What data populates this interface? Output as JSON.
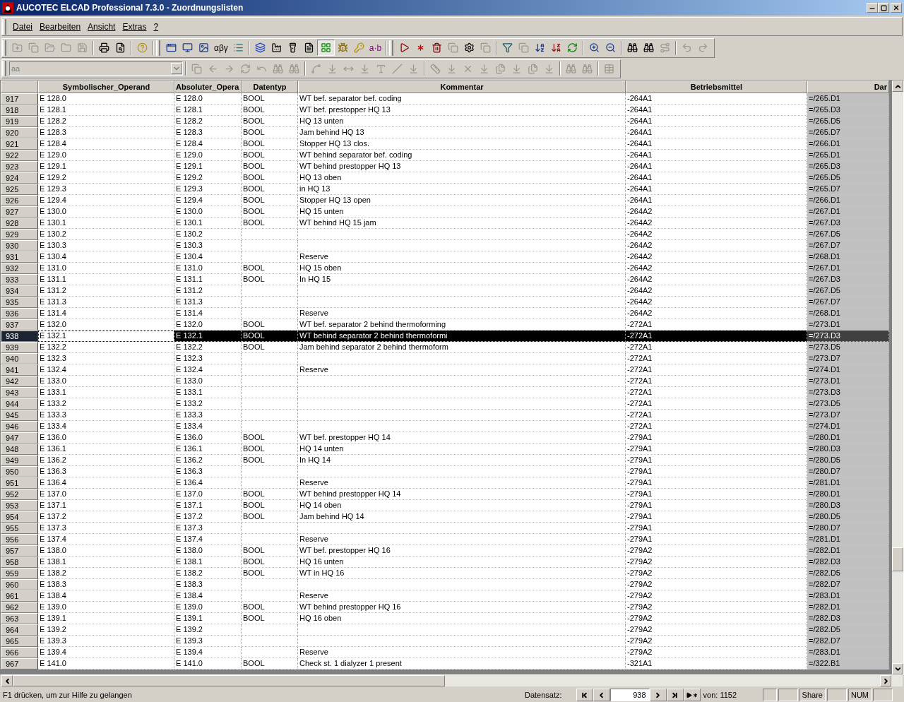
{
  "window": {
    "title": "AUCOTEC ELCAD Professional 7.3.0 - Zuordnungslisten"
  },
  "menu": [
    {
      "label": "Datei"
    },
    {
      "label": "Bearbeiten"
    },
    {
      "label": "Ansicht"
    },
    {
      "label": "Extras"
    },
    {
      "label": "?"
    }
  ],
  "toolbar": {
    "greek_label": "αβγ",
    "ab_label": "a·b",
    "style_dropdown": {
      "value": "aa",
      "disabled": true
    }
  },
  "table": {
    "columns": [
      "Symbolischer_Operand",
      "Absoluter_Opera",
      "Datentyp",
      "Kommentar",
      "Betriebsmittel",
      "Dar"
    ],
    "rows": [
      {
        "n": "917",
        "sym": "E 128.0",
        "abs": "E 128.0",
        "typ": "BOOL",
        "komm": "WT bef. separator bef. coding",
        "bm": "-264A1",
        "dar": "=/265.D1",
        "selected": false
      },
      {
        "n": "918",
        "sym": "E 128.1",
        "abs": "E 128.1",
        "typ": "BOOL",
        "komm": "WT bef. prestopper HQ 13",
        "bm": "-264A1",
        "dar": "=/265.D3",
        "selected": false
      },
      {
        "n": "919",
        "sym": "E 128.2",
        "abs": "E 128.2",
        "typ": "BOOL",
        "komm": "HQ 13 unten",
        "bm": "-264A1",
        "dar": "=/265.D5",
        "selected": false
      },
      {
        "n": "920",
        "sym": "E 128.3",
        "abs": "E 128.3",
        "typ": "BOOL",
        "komm": "Jam behind HQ 13",
        "bm": "-264A1",
        "dar": "=/265.D7",
        "selected": false
      },
      {
        "n": "921",
        "sym": "E 128.4",
        "abs": "E 128.4",
        "typ": "BOOL",
        "komm": "Stopper HQ 13 clos.",
        "bm": "-264A1",
        "dar": "=/266.D1",
        "selected": false
      },
      {
        "n": "922",
        "sym": "E 129.0",
        "abs": "E 129.0",
        "typ": "BOOL",
        "komm": "WT behind separator bef. coding",
        "bm": "-264A1",
        "dar": "=/265.D1",
        "selected": false
      },
      {
        "n": "923",
        "sym": "E 129.1",
        "abs": "E 129.1",
        "typ": "BOOL",
        "komm": "WT behind prestopper HQ 13",
        "bm": "-264A1",
        "dar": "=/265.D3",
        "selected": false
      },
      {
        "n": "924",
        "sym": "E 129.2",
        "abs": "E 129.2",
        "typ": "BOOL",
        "komm": "HQ 13 oben",
        "bm": "-264A1",
        "dar": "=/265.D5",
        "selected": false
      },
      {
        "n": "925",
        "sym": "E 129.3",
        "abs": "E 129.3",
        "typ": "BOOL",
        "komm": "in HQ 13",
        "bm": "-264A1",
        "dar": "=/265.D7",
        "selected": false
      },
      {
        "n": "926",
        "sym": "E 129.4",
        "abs": "E 129.4",
        "typ": "BOOL",
        "komm": "Stopper HQ 13 open",
        "bm": "-264A1",
        "dar": "=/266.D1",
        "selected": false
      },
      {
        "n": "927",
        "sym": "E 130.0",
        "abs": "E 130.0",
        "typ": "BOOL",
        "komm": "HQ 15 unten",
        "bm": "-264A2",
        "dar": "=/267.D1",
        "selected": false
      },
      {
        "n": "928",
        "sym": "E 130.1",
        "abs": "E 130.1",
        "typ": "BOOL",
        "komm": "WT behind HQ 15 jam",
        "bm": "-264A2",
        "dar": "=/267.D3",
        "selected": false
      },
      {
        "n": "929",
        "sym": "E 130.2",
        "abs": "E 130.2",
        "bm": "-264A2",
        "dar": "=/267.D5",
        "selected": false
      },
      {
        "n": "930",
        "sym": "E 130.3",
        "abs": "E 130.3",
        "bm": "-264A2",
        "dar": "=/267.D7",
        "selected": false
      },
      {
        "n": "931",
        "sym": "E 130.4",
        "abs": "E 130.4",
        "komm": "Reserve",
        "bm": "-264A2",
        "dar": "=/268.D1",
        "selected": false
      },
      {
        "n": "932",
        "sym": "E 131.0",
        "abs": "E 131.0",
        "typ": "BOOL",
        "komm": "HQ 15 oben",
        "bm": "-264A2",
        "dar": "=/267.D1",
        "selected": false
      },
      {
        "n": "933",
        "sym": "E 131.1",
        "abs": "E 131.1",
        "typ": "BOOL",
        "komm": "In HQ 15",
        "bm": "-264A2",
        "dar": "=/267.D3",
        "selected": false
      },
      {
        "n": "934",
        "sym": "E 131.2",
        "abs": "E 131.2",
        "bm": "-264A2",
        "dar": "=/267.D5",
        "selected": false
      },
      {
        "n": "935",
        "sym": "E 131.3",
        "abs": "E 131.3",
        "bm": "-264A2",
        "dar": "=/267.D7",
        "selected": false
      },
      {
        "n": "936",
        "sym": "E 131.4",
        "abs": "E 131.4",
        "komm": "Reserve",
        "bm": "-264A2",
        "dar": "=/268.D1",
        "selected": false
      },
      {
        "n": "937",
        "sym": "E 132.0",
        "abs": "E 132.0",
        "typ": "BOOL",
        "komm": "WT bef. separator 2 behind thermoforming",
        "bm": "-272A1",
        "dar": "=/273.D1",
        "selected": false
      },
      {
        "n": "938",
        "sym": "E 132.1",
        "abs": "E 132.1",
        "typ": "BOOL",
        "komm": "WT behind separator 2 behind thermoformi",
        "bm": "-272A1",
        "dar": "=/273.D3",
        "selected": true
      },
      {
        "n": "939",
        "sym": "E 132.2",
        "abs": "E 132.2",
        "typ": "BOOL",
        "komm": "Jam behind separator 2 behind thermoform",
        "bm": "-272A1",
        "dar": "=/273.D5",
        "selected": false
      },
      {
        "n": "940",
        "sym": "E 132.3",
        "abs": "E 132.3",
        "bm": "-272A1",
        "dar": "=/273.D7",
        "selected": false
      },
      {
        "n": "941",
        "sym": "E 132.4",
        "abs": "E 132.4",
        "komm": "Reserve",
        "bm": "-272A1",
        "dar": "=/274.D1",
        "selected": false
      },
      {
        "n": "942",
        "sym": "E 133.0",
        "abs": "E 133.0",
        "bm": "-272A1",
        "dar": "=/273.D1",
        "selected": false
      },
      {
        "n": "943",
        "sym": "E 133.1",
        "abs": "E 133.1",
        "bm": "-272A1",
        "dar": "=/273.D3",
        "selected": false
      },
      {
        "n": "944",
        "sym": "E 133.2",
        "abs": "E 133.2",
        "bm": "-272A1",
        "dar": "=/273.D5",
        "selected": false
      },
      {
        "n": "945",
        "sym": "E 133.3",
        "abs": "E 133.3",
        "bm": "-272A1",
        "dar": "=/273.D7",
        "selected": false
      },
      {
        "n": "946",
        "sym": "E 133.4",
        "abs": "E 133.4",
        "bm": "-272A1",
        "dar": "=/274.D1",
        "selected": false
      },
      {
        "n": "947",
        "sym": "E 136.0",
        "abs": "E 136.0",
        "typ": "BOOL",
        "komm": "WT bef. prestopper HQ 14",
        "bm": "-279A1",
        "dar": "=/280.D1",
        "selected": false
      },
      {
        "n": "948",
        "sym": "E 136.1",
        "abs": "E 136.1",
        "typ": "BOOL",
        "komm": "HQ 14 unten",
        "bm": "-279A1",
        "dar": "=/280.D3",
        "selected": false
      },
      {
        "n": "949",
        "sym": "E 136.2",
        "abs": "E 136.2",
        "typ": "BOOL",
        "komm": "In HQ 14",
        "bm": "-279A1",
        "dar": "=/280.D5",
        "selected": false
      },
      {
        "n": "950",
        "sym": "E 136.3",
        "abs": "E 136.3",
        "bm": "-279A1",
        "dar": "=/280.D7",
        "selected": false
      },
      {
        "n": "951",
        "sym": "E 136.4",
        "abs": "E 136.4",
        "komm": "Reserve",
        "bm": "-279A1",
        "dar": "=/281.D1",
        "selected": false
      },
      {
        "n": "952",
        "sym": "E 137.0",
        "abs": "E 137.0",
        "typ": "BOOL",
        "komm": "WT behind prestopper HQ 14",
        "bm": "-279A1",
        "dar": "=/280.D1",
        "selected": false
      },
      {
        "n": "953",
        "sym": "E 137.1",
        "abs": "E 137.1",
        "typ": "BOOL",
        "komm": "HQ 14 oben",
        "bm": "-279A1",
        "dar": "=/280.D3",
        "selected": false
      },
      {
        "n": "954",
        "sym": "E 137.2",
        "abs": "E 137.2",
        "typ": "BOOL",
        "komm": "Jam behind HQ 14",
        "bm": "-279A1",
        "dar": "=/280.D5",
        "selected": false
      },
      {
        "n": "955",
        "sym": "E 137.3",
        "abs": "E 137.3",
        "bm": "-279A1",
        "dar": "=/280.D7",
        "selected": false
      },
      {
        "n": "956",
        "sym": "E 137.4",
        "abs": "E 137.4",
        "komm": "Reserve",
        "bm": "-279A1",
        "dar": "=/281.D1",
        "selected": false
      },
      {
        "n": "957",
        "sym": "E 138.0",
        "abs": "E 138.0",
        "typ": "BOOL",
        "komm": "WT bef. prestopper HQ 16",
        "bm": "-279A2",
        "dar": "=/282.D1",
        "selected": false
      },
      {
        "n": "958",
        "sym": "E 138.1",
        "abs": "E 138.1",
        "typ": "BOOL",
        "komm": "HQ 16 unten",
        "bm": "-279A2",
        "dar": "=/282.D3",
        "selected": false
      },
      {
        "n": "959",
        "sym": "E 138.2",
        "abs": "E 138.2",
        "typ": "BOOL",
        "komm": "WT in HQ 16",
        "bm": "-279A2",
        "dar": "=/282.D5",
        "selected": false
      },
      {
        "n": "960",
        "sym": "E 138.3",
        "abs": "E 138.3",
        "bm": "-279A2",
        "dar": "=/282.D7",
        "selected": false
      },
      {
        "n": "961",
        "sym": "E 138.4",
        "abs": "E 138.4",
        "komm": "Reserve",
        "bm": "-279A2",
        "dar": "=/283.D1",
        "selected": false
      },
      {
        "n": "962",
        "sym": "E 139.0",
        "abs": "E 139.0",
        "typ": "BOOL",
        "komm": "WT behind prestopper HQ 16",
        "bm": "-279A2",
        "dar": "=/282.D1",
        "selected": false
      },
      {
        "n": "963",
        "sym": "E 139.1",
        "abs": "E 139.1",
        "typ": "BOOL",
        "komm": "HQ 16 oben",
        "bm": "-279A2",
        "dar": "=/282.D3",
        "selected": false
      },
      {
        "n": "964",
        "sym": "E 139.2",
        "abs": "E 139.2",
        "bm": "-279A2",
        "dar": "=/282.D5",
        "selected": false
      },
      {
        "n": "965",
        "sym": "E 139.3",
        "abs": "E 139.3",
        "bm": "-279A2",
        "dar": "=/282.D7",
        "selected": false
      },
      {
        "n": "966",
        "sym": "E 139.4",
        "abs": "E 139.4",
        "komm": "Reserve",
        "bm": "-279A2",
        "dar": "=/283.D1",
        "selected": false
      },
      {
        "n": "967",
        "sym": "E 141.0",
        "abs": "E 141.0",
        "typ": "BOOL",
        "komm": "Check st. 1 dialyzer 1 present",
        "bm": "-321A1",
        "dar": "=/322.B1",
        "selected": false
      }
    ]
  },
  "status_bar": {
    "hint": "F1 drücken, um zur Hilfe zu gelangen",
    "record_label": "Datensatz:",
    "record_value": "938",
    "record_total": "von: 1152",
    "indicators": [
      {
        "label": "Share"
      },
      {
        "label": "NUM"
      }
    ]
  }
}
